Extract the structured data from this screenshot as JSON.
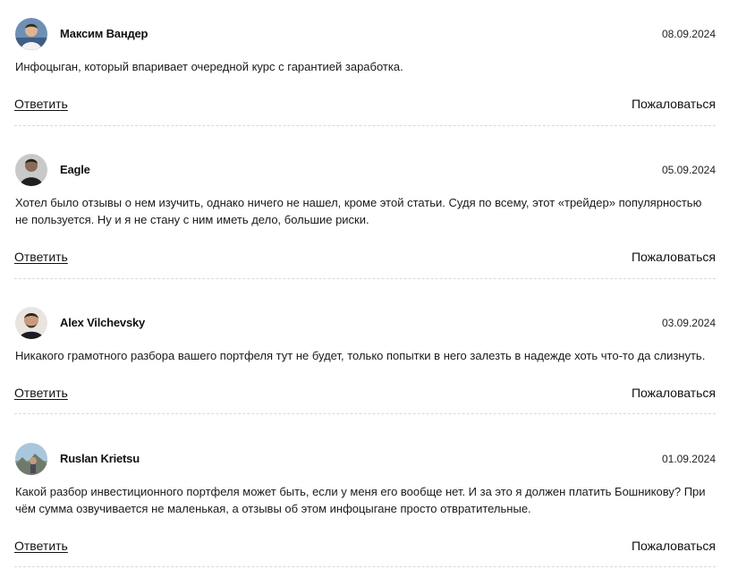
{
  "comments": [
    {
      "author": "Максим Вандер",
      "date": "08.09.2024",
      "text": "Инфоцыган, который впаривает очередной курс с гарантией заработка.",
      "reply_label": "Ответить",
      "report_label": "Пожаловаться"
    },
    {
      "author": "Eagle",
      "date": "05.09.2024",
      "text": "Хотел было отзывы о нем изучить, однако ничего не нашел, кроме этой статьи. Судя по всему, этот «трейдер» популярностью не пользуется. Ну и я не стану с ним иметь дело, большие риски.",
      "reply_label": "Ответить",
      "report_label": "Пожаловаться"
    },
    {
      "author": "Alex Vilchevsky",
      "date": "03.09.2024",
      "text": "Никакого грамотного разбора вашего портфеля тут не будет, только попытки в него залезть в надежде хоть что-то да слизнуть.",
      "reply_label": "Ответить",
      "report_label": "Пожаловаться"
    },
    {
      "author": "Ruslan Krietsu",
      "date": "01.09.2024",
      "text": "Какой разбор инвестиционного портфеля может быть, если у меня его вообще нет. И за это я должен платить Бошникову? При чём сумма озвучивается не маленькая, а отзывы об этом инфоцыгане просто отвратительные.",
      "reply_label": "Ответить",
      "report_label": "Пожаловаться"
    }
  ]
}
